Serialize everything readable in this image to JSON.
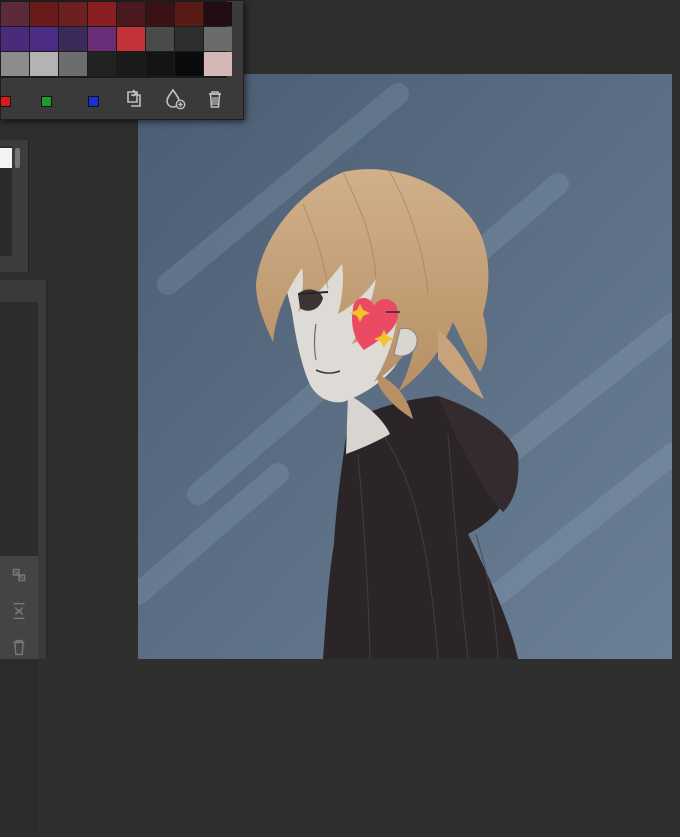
{
  "colors": {
    "workspace": "#2e2e2e",
    "panel": "#3b3b3b",
    "canvas_bg": "#58708a",
    "hair": "#c9a77f",
    "skin": "#dedad5",
    "hoodie": "#2c2528",
    "heart": "#ea4b62",
    "sparkle": "#f4c22a"
  },
  "palette": {
    "swatches": [
      "#5c2a39",
      "#6b1a1a",
      "#6e1f1f",
      "#8b1e22",
      "#4b1a1f",
      "#3a1214",
      "#5a1b17",
      "#220d16",
      "#4a2a7a",
      "#4d2c86",
      "#3b2a5a",
      "#6a2d78",
      "#c4323a",
      "#4a4a4a",
      "#2e2e2e",
      "#6b6b6b",
      "#8c8c8c",
      "#b3b3b3",
      "#6d6d6d",
      "#222222",
      "#1b1b1b",
      "#141414",
      "#0b0b0b",
      "#d6b7b7"
    ],
    "mini_swatches": [
      "#d91a1a",
      "#1e9b2a",
      "#1a2ed1"
    ],
    "tools": [
      "copy-icon",
      "fill-color-add-icon",
      "trash-icon"
    ]
  },
  "dock": {
    "icons": [
      "resize-icon",
      "merge-down-icon",
      "trash-icon"
    ]
  }
}
